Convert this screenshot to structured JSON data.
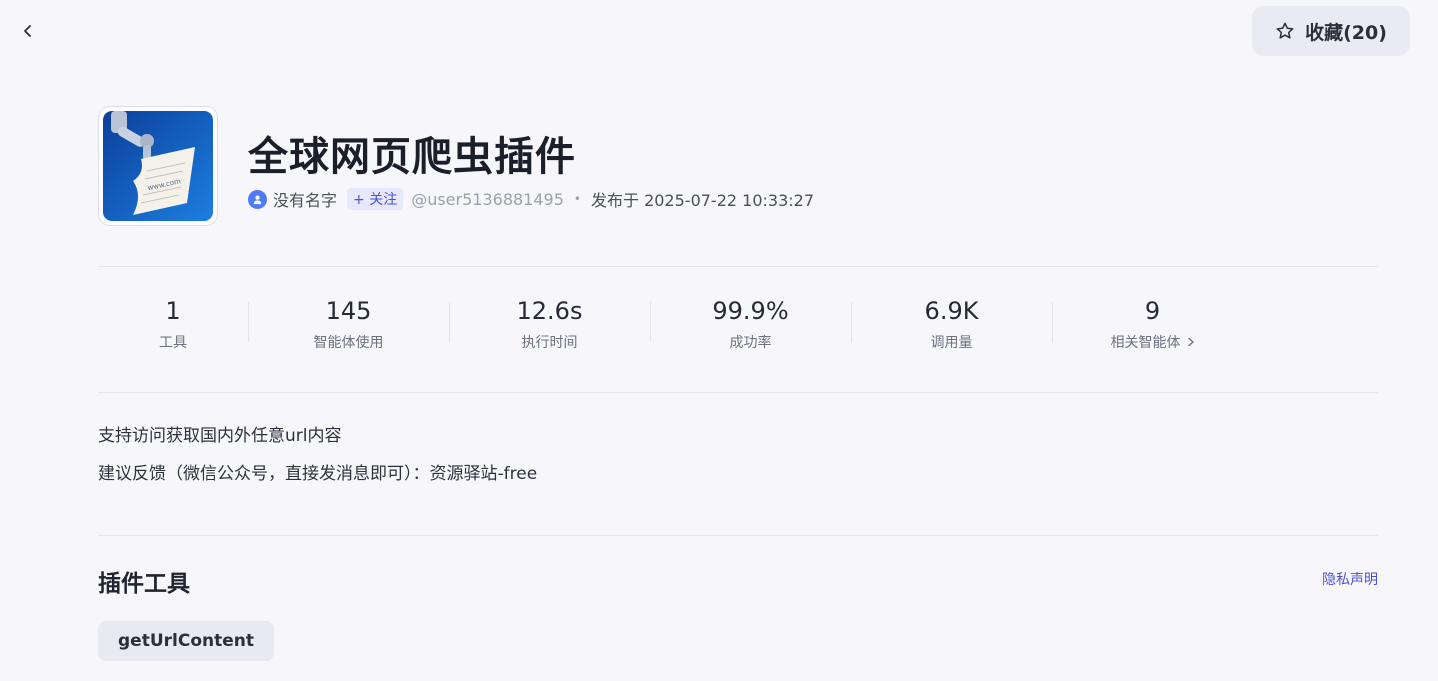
{
  "header": {
    "back_icon": "chevron-left-icon",
    "favorite_icon": "star-outline-icon",
    "favorite_label": "收藏(20)"
  },
  "plugin": {
    "logo_text": "www.com",
    "title": "全球网页爬虫插件",
    "author_name": "没有名字",
    "follow_label": "+ 关注",
    "user_handle": "@user5136881495",
    "separator": "•",
    "published": "发布于 2025-07-22 10:33:27"
  },
  "stats": [
    {
      "value": "1",
      "label": "工具"
    },
    {
      "value": "145",
      "label": "智能体使用"
    },
    {
      "value": "12.6s",
      "label": "执行时间"
    },
    {
      "value": "99.9%",
      "label": "成功率"
    },
    {
      "value": "6.9K",
      "label": "调用量"
    },
    {
      "value": "9",
      "label": "相关智能体"
    }
  ],
  "description": {
    "line1": "支持访问获取国内外任意url内容",
    "line2": "建议反馈（微信公众号，直接发消息即可）：资源驿站-free"
  },
  "tools_section": {
    "title": "插件工具",
    "privacy_link": "隐私声明",
    "tools": [
      "getUrlContent"
    ]
  },
  "colors": {
    "accent": "#4b52d6",
    "background": "#f7f7fb",
    "avatar": "#4f7cf6"
  }
}
